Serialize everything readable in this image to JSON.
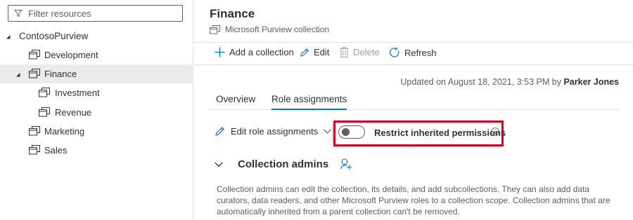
{
  "filter": {
    "placeholder": "Filter resources"
  },
  "tree": {
    "root": "ContosoPurview",
    "items": [
      {
        "label": "Development"
      },
      {
        "label": "Finance"
      },
      {
        "label": "Investment"
      },
      {
        "label": "Revenue"
      },
      {
        "label": "Marketing"
      },
      {
        "label": "Sales"
      }
    ]
  },
  "header": {
    "title": "Finance",
    "subtitle": "Microsoft Purview collection"
  },
  "toolbar": {
    "add": "Add a collection",
    "edit": "Edit",
    "delete": "Delete",
    "refresh": "Refresh"
  },
  "updated": {
    "prefix": "Updated on August 18, 2021, 3:53 PM by ",
    "user": "Parker Jones"
  },
  "tabs": [
    {
      "label": "Overview"
    },
    {
      "label": "Role assignments"
    }
  ],
  "role_assignments": {
    "edit_label": "Edit role assignments",
    "restrict_label": "Restrict inherited permissions",
    "restrict_on": false,
    "section_title": "Collection admins",
    "description": "Collection admins can edit the collection, its details, and add subcollections. They can also add data curators, data readers, and other Microsoft Purview roles to a collection scope. Collection admins that are automatically inherited from a parent collection can't be removed."
  },
  "icons": {
    "filter": "filter-icon",
    "collection": "collection-icon",
    "add": "plus-icon",
    "edit": "pencil-icon",
    "delete": "trash-icon",
    "refresh": "refresh-icon",
    "info": "info-icon",
    "add_person": "add-person-icon"
  },
  "colors": {
    "accent": "#0078d4",
    "highlight": "#e3001b",
    "selected_row": "#edebe9"
  }
}
